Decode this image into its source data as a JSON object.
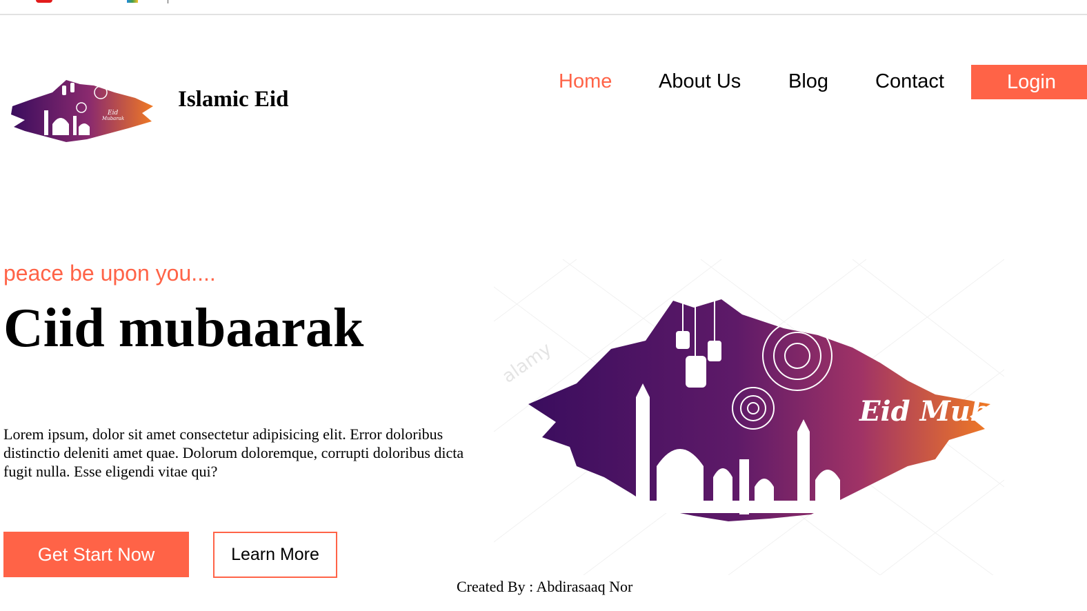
{
  "site": {
    "title": "Islamic Eid"
  },
  "nav": {
    "items": [
      {
        "label": "Home",
        "active": true
      },
      {
        "label": "About Us",
        "active": false
      },
      {
        "label": "Blog",
        "active": false
      },
      {
        "label": "Contact",
        "active": false
      }
    ],
    "login_label": "Login"
  },
  "hero": {
    "tagline": "peace be upon you....",
    "headline": "Ciid mubaarak",
    "body": "Lorem ipsum, dolor sit amet consectetur adipisicing elit. Error doloribus distinctio deleniti amet quae. Dolorum doloremque, corrupti doloribus dicta fugit nulla. Esse eligendi vitae qui?",
    "primary_button": "Get Start Now",
    "secondary_button": "Learn More",
    "image_lettering": "Eid Mubarak",
    "watermark": "alamy"
  },
  "footer": {
    "credit": "Created By : Abdirasaaq Nor"
  },
  "colors": {
    "accent": "#ff6347",
    "purple_dark": "#3a0d5e",
    "purple_mid": "#7b1f6a",
    "orange": "#f07a24"
  },
  "icons": {
    "logo": "mosque-eid-logo",
    "hero": "mosque-eid-illustration"
  }
}
